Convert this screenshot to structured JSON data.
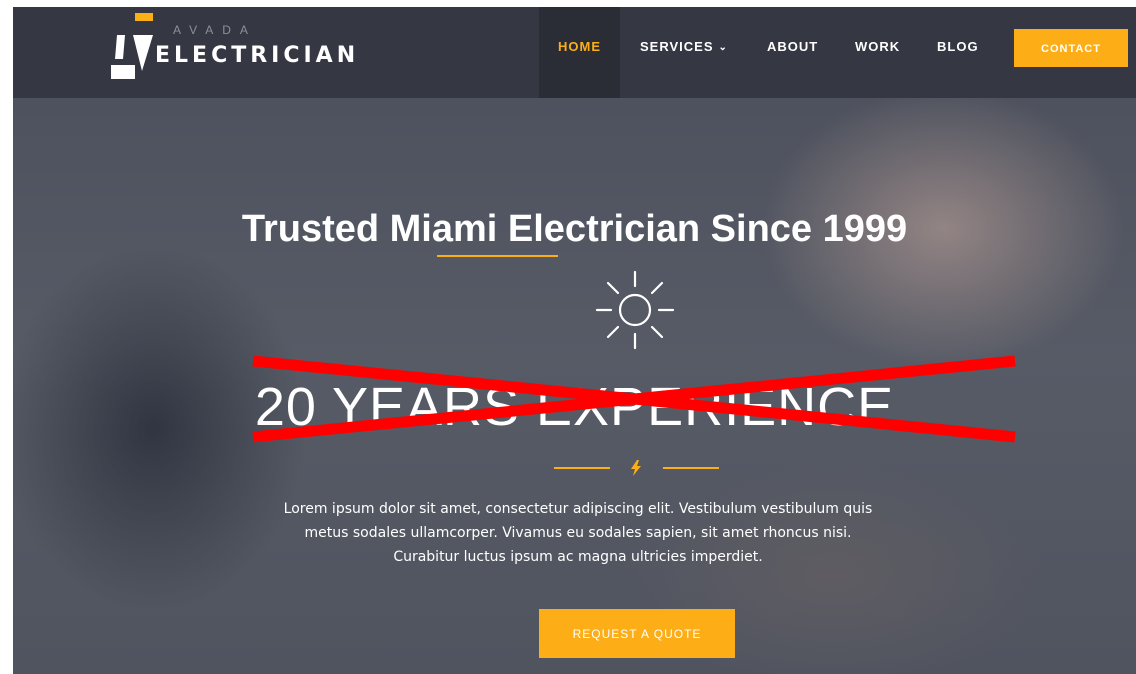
{
  "logo": {
    "top_text": "AVADA",
    "main_text": "ELECTRICIAN"
  },
  "nav": {
    "items": [
      {
        "label": "HOME",
        "active": true
      },
      {
        "label": "SERVICES",
        "has_dropdown": true
      },
      {
        "label": "ABOUT"
      },
      {
        "label": "WORK"
      },
      {
        "label": "BLOG"
      }
    ],
    "dropdown_icon": "chevron-down-icon",
    "contact_label": "CONTACT"
  },
  "hero": {
    "title": "Trusted Miami Electrician Since 1999",
    "big_text": "20 YEARS EXPERIENCE",
    "big_text_crossed_out": true,
    "icon": "sun-icon",
    "divider_icon": "lightning-bolt-icon",
    "description": "Lorem ipsum dolor sit amet, consectetur adipiscing elit. Vestibulum vestibulum quis metus sodales ullamcorper. Vivamus eu sodales sapien, sit amet rhoncus nisi. Curabitur luctus ipsum ac magna ultricies imperdiet.",
    "cta_label": "REQUEST A QUOTE"
  },
  "colors": {
    "accent": "#fdae17",
    "header_bg": "#353843",
    "strike": "#ff0000"
  }
}
